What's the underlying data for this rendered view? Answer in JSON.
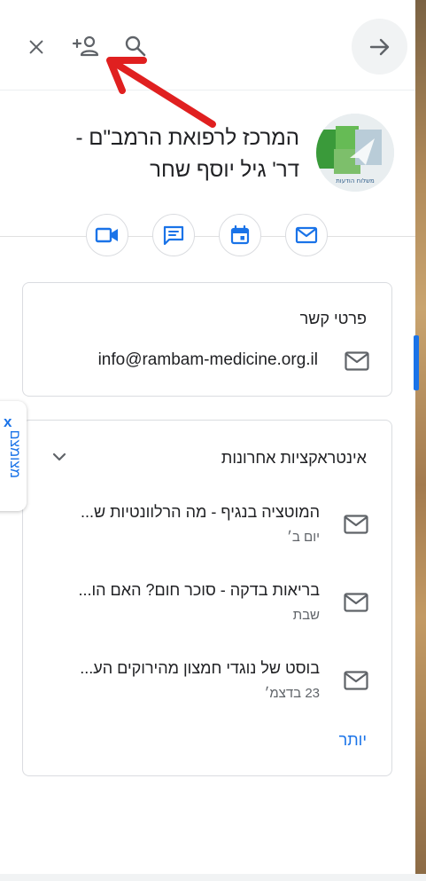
{
  "colors": {
    "accent": "#1a73e8",
    "annotation_arrow": "#e02020",
    "icon_gray": "#5f6368"
  },
  "toolbar": {
    "close_icon": "close-icon",
    "add_contact_icon": "person-add-icon",
    "search_icon": "search-icon",
    "back_icon": "arrow-forward-icon"
  },
  "contact": {
    "name_line1": "המרכז לרפואת הרמב\"ם -",
    "name_line2": "דר' גיל יוסף שחר",
    "avatar_caption": "משלוח הודעות"
  },
  "actions": [
    {
      "name": "email",
      "icon": "mail-icon"
    },
    {
      "name": "calendar",
      "icon": "calendar-icon"
    },
    {
      "name": "chat",
      "icon": "chat-icon"
    },
    {
      "name": "video",
      "icon": "video-icon"
    }
  ],
  "contact_details": {
    "title": "פרטי קשר",
    "email": "info@rambam-medicine.org.il"
  },
  "recent_interactions": {
    "title": "אינטראקציות אחרונות",
    "items": [
      {
        "subject": "המוטציה בנגיף - מה הרלוונטיות ש...",
        "date": "יום ב׳"
      },
      {
        "subject": "בריאות בדקה - סוכר חום? האם הו...",
        "date": "שבת"
      },
      {
        "subject": "בוסט של נוגדי חמצון מהירוקים הע...",
        "date": "23 בדצמ׳"
      }
    ],
    "more_label": "יותר"
  },
  "side_tab": {
    "close": "x",
    "label": "מצומצם"
  }
}
